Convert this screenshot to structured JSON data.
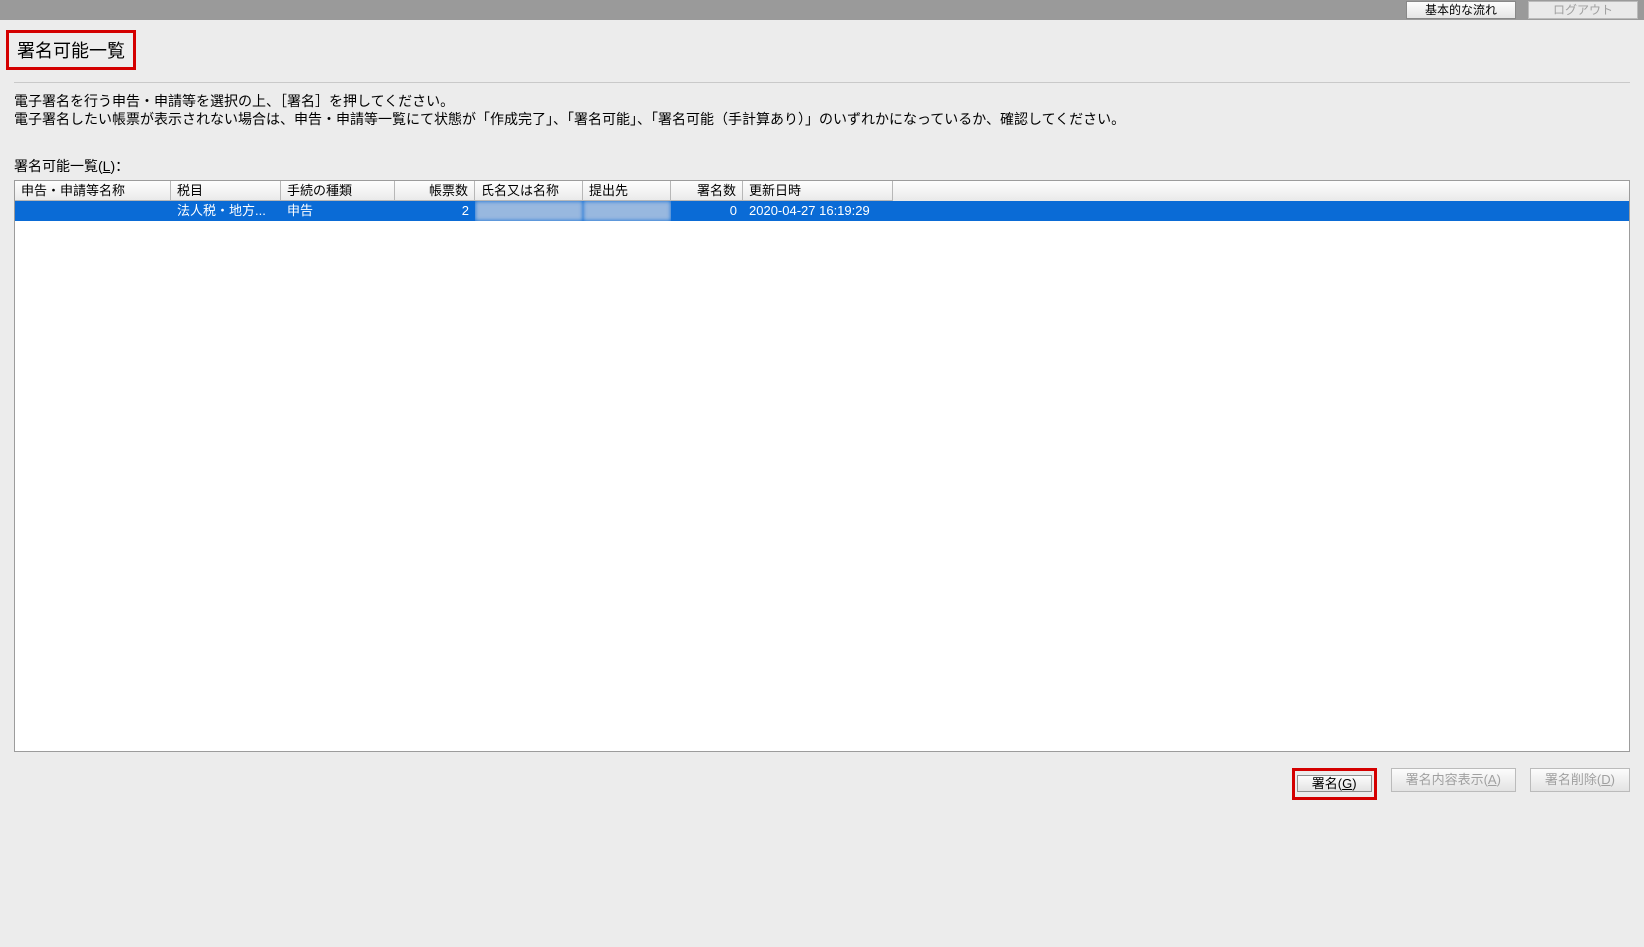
{
  "topbar": {
    "basic_flow": "基本的な流れ",
    "logout": "ログアウト"
  },
  "page_title": "署名可能一覧",
  "description": {
    "line1": "電子署名を行う申告・申請等を選択の上、［署名］を押してください。",
    "line2": "電子署名したい帳票が表示されない場合は、申告・申請等一覧にて状態が「作成完了」、「署名可能」、「署名可能（手計算あり）」のいずれかになっているか、確認してください。"
  },
  "list_label": "署名可能一覧(L)：",
  "columns": {
    "c1": "申告・申請等名称",
    "c2": "税目",
    "c3": "手続の種類",
    "c4": "帳票数",
    "c5": "氏名又は名称",
    "c6": "提出先",
    "c7": "署名数",
    "c8": "更新日時"
  },
  "row": {
    "name": "",
    "tax": "法人税・地方...",
    "proc": "申告",
    "forms": "2",
    "person": "",
    "dest": "",
    "sigcount": "0",
    "updated": "2020-04-27 16:19:29"
  },
  "buttons": {
    "sign": "署名(G)",
    "view": "署名内容表示(A)",
    "delete": "署名削除(D)"
  }
}
